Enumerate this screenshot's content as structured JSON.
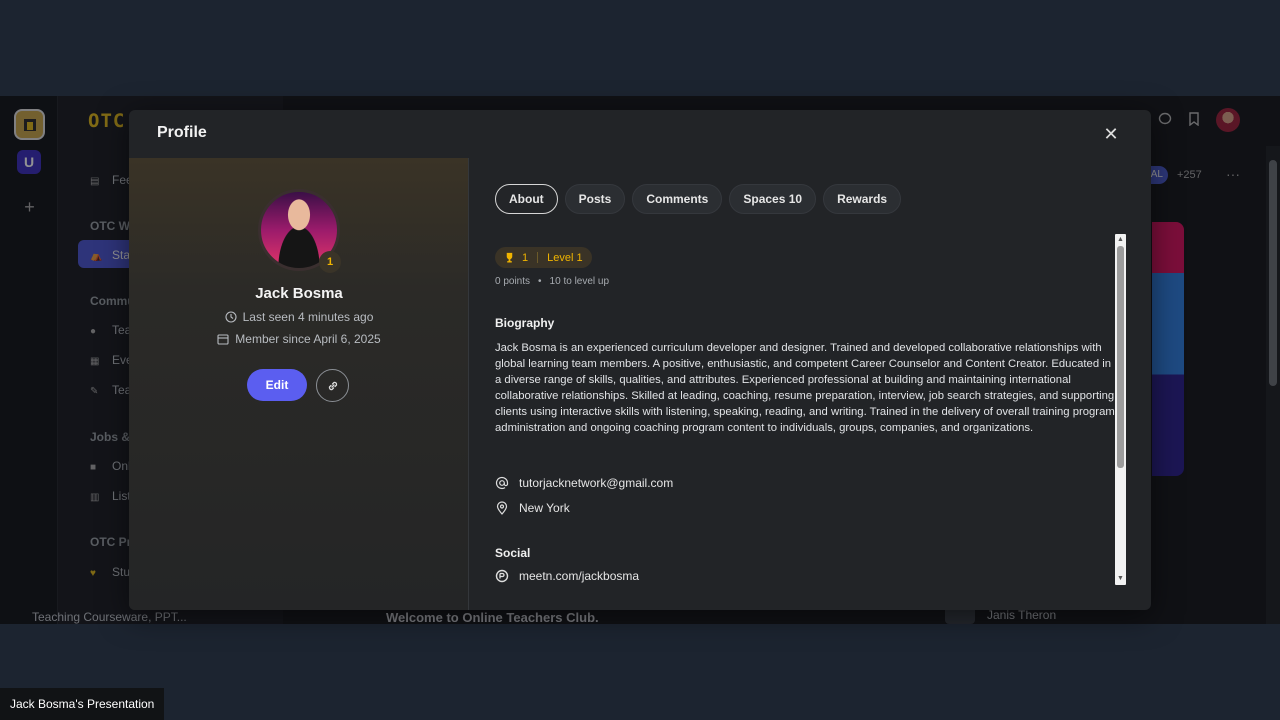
{
  "app": {
    "logo": "OTC",
    "rail_u_label": "U",
    "sidebar": {
      "items": [
        {
          "label": "Fee",
          "icon": "feed-icon"
        },
        {
          "label": "OTC W",
          "section": true
        },
        {
          "label": "Sta",
          "icon": "start-icon",
          "active": true
        },
        {
          "label": "Commu",
          "section": true
        },
        {
          "label": "Tea",
          "icon": "chat-icon"
        },
        {
          "label": "Eve",
          "icon": "calendar-icon"
        },
        {
          "label": "Tea",
          "icon": "tools-icon"
        },
        {
          "label": "Jobs &",
          "section": true
        },
        {
          "label": "Onl",
          "icon": "briefcase-icon"
        },
        {
          "label": "List",
          "icon": "list-icon"
        },
        {
          "label": "OTC Pr",
          "section": true
        },
        {
          "label": "Stu",
          "icon": "heart-icon"
        }
      ],
      "bottom_label": "Teaching Courseware, PPT..."
    },
    "header_chip": "AL",
    "member_count": "+257",
    "welcome_text": "Welcome to Online Teachers Club.",
    "member_name": "Janis Theron"
  },
  "modal": {
    "title": "Profile",
    "close_label": "✕",
    "profile": {
      "name": "Jack Bosma",
      "level_number": "1",
      "last_seen": "Last seen 4 minutes ago",
      "member_since": "Member since April 6, 2025",
      "edit_label": "Edit"
    },
    "tabs": [
      {
        "label": "About",
        "active": true
      },
      {
        "label": "Posts",
        "active": false
      },
      {
        "label": "Comments",
        "active": false
      },
      {
        "label": "Spaces 10",
        "active": false
      },
      {
        "label": "Rewards",
        "active": false
      }
    ],
    "about": {
      "level_count": "1",
      "level_label": "Level 1",
      "points": "0 points",
      "to_level_up": "10 to level up",
      "biography_heading": "Biography",
      "biography": "Jack Bosma is an experienced curriculum developer and designer. Trained and developed collaborative relationships with global learning team members. A positive, enthusiastic, and competent Career Counselor and Content Creator. Educated in a diverse range of skills, qualities, and attributes. Experienced professional at building and maintaining international collaborative relationships. Skilled at leading, coaching, resume preparation, interview, job search strategies, and supporting clients using interactive skills with listening, speaking, reading, and writing. Trained in the delivery of overall training program administration and ongoing coaching program content to individuals, groups, companies, and organizations.",
      "email": "tutorjacknetwork@gmail.com",
      "location": "New York",
      "social_heading": "Social",
      "social_link": "meetn.com/jackbosma"
    }
  },
  "presenter_label": "Jack Bosma's Presentation",
  "colors": {
    "accent": "#5b5ef0",
    "level_gold": "#f0b400",
    "background": "#1c2430"
  }
}
